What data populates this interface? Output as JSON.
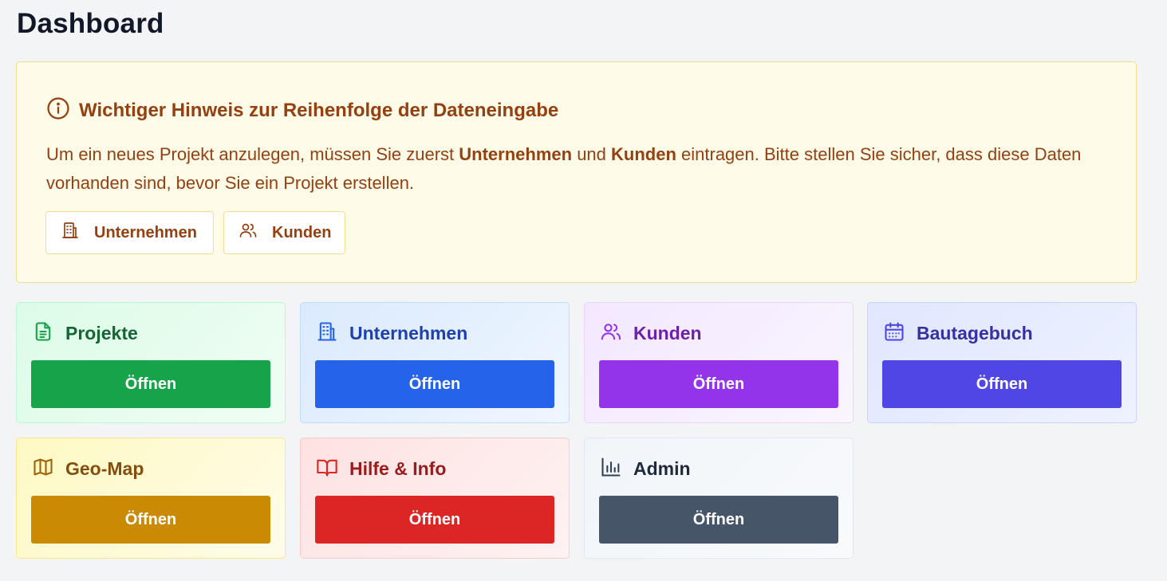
{
  "page": {
    "title": "Dashboard"
  },
  "notice": {
    "icon": "info-circle-icon",
    "title": "Wichtiger Hinweis zur Reihenfolge der Dateneingabe",
    "text_part1": "Um ein neues Projekt anzulegen, müssen Sie zuerst ",
    "text_bold1": "Unternehmen",
    "text_part2": " und ",
    "text_bold2": "Kunden",
    "text_part3": " eintragen. Bitte stellen Sie sicher, dass diese Daten vorhanden sind, bevor Sie ein Projekt erstellen.",
    "buttons": [
      {
        "label": "Unternehmen",
        "icon": "building-icon"
      },
      {
        "label": "Kunden",
        "icon": "users-icon"
      }
    ],
    "colors": {
      "background": "#fefbe8",
      "border": "#f6dd8a",
      "text": "#954010"
    }
  },
  "cards": [
    {
      "title": "Projekte",
      "icon": "file-text-icon",
      "button": "Öffnen",
      "accent": "#16a34a",
      "title_color": "#166534"
    },
    {
      "title": "Unternehmen",
      "icon": "building-icon",
      "button": "Öffnen",
      "accent": "#2563eb",
      "title_color": "#1e40af"
    },
    {
      "title": "Kunden",
      "icon": "users-icon",
      "button": "Öffnen",
      "accent": "#9333ea",
      "title_color": "#6b21a8"
    },
    {
      "title": "Bautagebuch",
      "icon": "calendar-icon",
      "button": "Öffnen",
      "accent": "#4f46e5",
      "title_color": "#3730a3"
    },
    {
      "title": "Geo-Map",
      "icon": "map-icon",
      "button": "Öffnen",
      "accent": "#ca8a04",
      "title_color": "#854d0e"
    },
    {
      "title": "Hilfe & Info",
      "icon": "book-open-icon",
      "button": "Öffnen",
      "accent": "#dc2626",
      "title_color": "#991b1b"
    },
    {
      "title": "Admin",
      "icon": "bar-chart-icon",
      "button": "Öffnen",
      "accent": "#475569",
      "title_color": "#1e293b"
    }
  ]
}
